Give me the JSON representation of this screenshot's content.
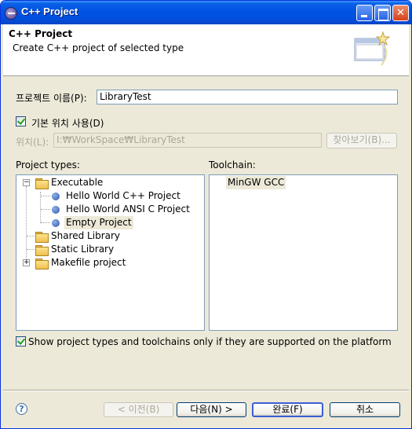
{
  "window": {
    "title": "C++ Project"
  },
  "header": {
    "title": "C++ Project",
    "description": "Create C++ project of selected type"
  },
  "form": {
    "project_name_label": "프로젝트 이름(P):",
    "project_name_value": "LibraryTest",
    "default_location_label": "기본 위치 사용(D)",
    "default_location_checked": true,
    "location_label": "위치(L):",
    "location_value": "I:₩WorkSpace₩LibraryTest",
    "browse_label": "찾아보기(B)..."
  },
  "project_types": {
    "label": "Project types:",
    "items": [
      {
        "label": "Executable",
        "kind": "folder",
        "expanded": true,
        "level": 0
      },
      {
        "label": "Hello World C++ Project",
        "kind": "item",
        "level": 1
      },
      {
        "label": "Hello World ANSI C Project",
        "kind": "item",
        "level": 1
      },
      {
        "label": "Empty Project",
        "kind": "item",
        "level": 1,
        "selected": true
      },
      {
        "label": "Shared Library",
        "kind": "folder",
        "level": 0
      },
      {
        "label": "Static Library",
        "kind": "folder",
        "level": 0
      },
      {
        "label": "Makefile project",
        "kind": "folder",
        "expanded": false,
        "level": 0
      }
    ]
  },
  "toolchain": {
    "label": "Toolchain:",
    "items": [
      {
        "label": "MinGW GCC",
        "selected": true
      }
    ]
  },
  "filter": {
    "label": "Show project types and toolchains only if they are supported on the platform",
    "checked": true
  },
  "buttons": {
    "back": "< 이전(B)",
    "next": "다음(N) >",
    "finish": "완료(F)",
    "cancel": "취소",
    "help": "?"
  },
  "colors": {
    "titlebar": "#0054e3",
    "selection": "#ece9d8",
    "dialog_bg": "#ece9d8"
  }
}
